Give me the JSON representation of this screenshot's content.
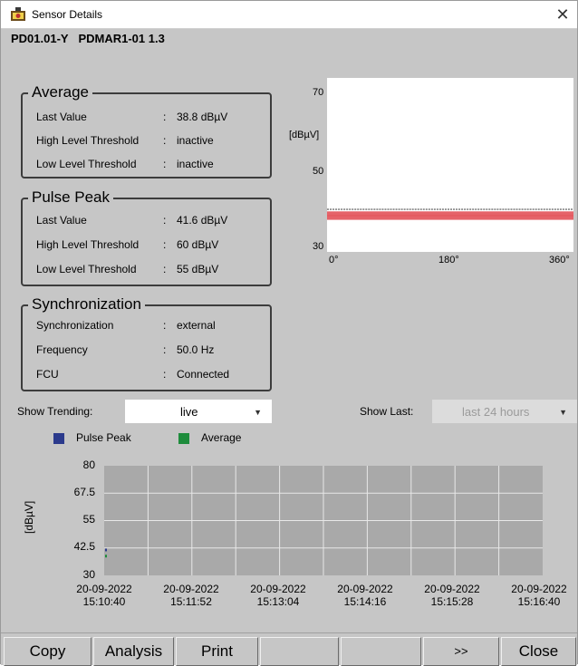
{
  "window": {
    "title": "Sensor Details",
    "close_glyph": "✕",
    "app_icon": "sensor-app-icon"
  },
  "device": {
    "id": "PD01.01-Y",
    "name": "PDMAR1-01 1.3"
  },
  "average": {
    "title": "Average",
    "rows": [
      {
        "label": "Last Value",
        "colon": ":",
        "value": "38.8 dBµV"
      },
      {
        "label": "High Level Threshold",
        "colon": ":",
        "value": "inactive"
      },
      {
        "label": "Low Level Threshold",
        "colon": ":",
        "value": "inactive"
      }
    ]
  },
  "pulse_peak": {
    "title": "Pulse Peak",
    "rows": [
      {
        "label": "Last Value",
        "colon": ":",
        "value": "41.6 dBµV"
      },
      {
        "label": "High Level Threshold",
        "colon": ":",
        "value": "60 dBµV"
      },
      {
        "label": "Low Level Threshold",
        "colon": ":",
        "value": "55 dBµV"
      }
    ]
  },
  "synchronization": {
    "title": "Synchronization",
    "rows": [
      {
        "label": "Synchronization",
        "colon": ":",
        "value": "external"
      },
      {
        "label": "Frequency",
        "colon": ":",
        "value": "50.0 Hz"
      },
      {
        "label": "FCU",
        "colon": ":",
        "value": "Connected"
      }
    ]
  },
  "trending": {
    "show_trending_label": "Show Trending:",
    "show_trending_value": "live",
    "show_last_label": "Show Last:",
    "show_last_value": "last 24 hours"
  },
  "legend": {
    "pulse_peak": "Pulse Peak",
    "average": "Average"
  },
  "colors": {
    "pulse_peak": "#2b3a8c",
    "average": "#1e8c3c",
    "phase_band": "#e0484f",
    "plot_bg": "#a9a9a9",
    "window_bg": "#c6c6c6"
  },
  "buttons": {
    "copy": "Copy",
    "analysis": "Analysis",
    "print": "Print",
    "blank1": "",
    "blank2": "",
    "more": ">>",
    "close": "Close"
  },
  "chart_data": [
    {
      "type": "scatter",
      "title": "",
      "ylabel": "[dBµV]",
      "xlabel": "",
      "yticks": [
        "70",
        "50",
        "30"
      ],
      "xticks": [
        "0°",
        "180°",
        "360°"
      ],
      "ylim": [
        30,
        70
      ],
      "xlim": [
        0,
        360
      ],
      "grid": false,
      "series": [
        {
          "values": [
            38.9,
            38.9
          ]
        },
        {
          "values": [
            38.0,
            38.0
          ]
        }
      ]
    },
    {
      "type": "line",
      "title": "",
      "ylabel": "[dBµV]",
      "xlabel": "",
      "yticks": [
        "80",
        "67.5",
        "55",
        "42.5",
        "30"
      ],
      "ylim": [
        30,
        80
      ],
      "grid": true,
      "x": [
        [
          "20-09-2022",
          "15:10:40"
        ],
        [
          "20-09-2022",
          "15:11:52"
        ],
        [
          "20-09-2022",
          "15:13:04"
        ],
        [
          "20-09-2022",
          "15:14:16"
        ],
        [
          "20-09-2022",
          "15:15:28"
        ],
        [
          "20-09-2022",
          "15:16:40"
        ]
      ],
      "series": [
        {
          "name": "Pulse Peak",
          "values": [
            41.6
          ]
        },
        {
          "name": "Average",
          "values": [
            38.8
          ]
        }
      ]
    }
  ]
}
